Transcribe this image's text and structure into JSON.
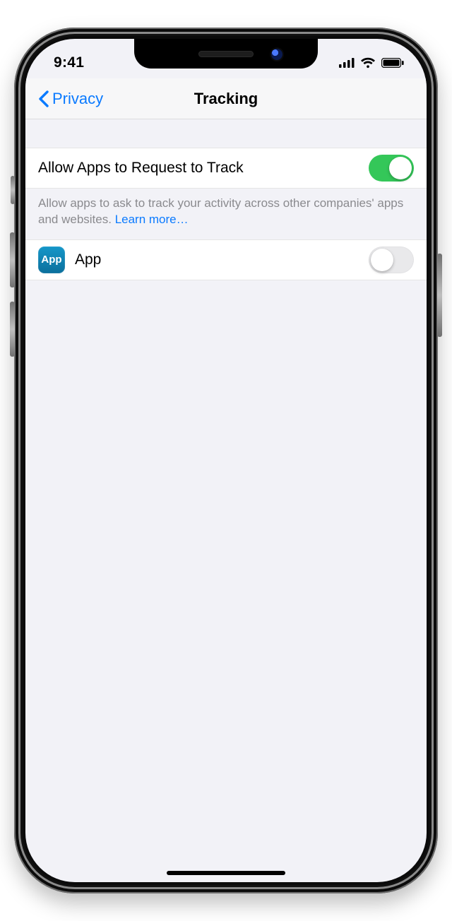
{
  "status": {
    "time": "9:41"
  },
  "nav": {
    "back_label": "Privacy",
    "title": "Tracking"
  },
  "rows": {
    "allow_label": "Allow Apps to Request to Track",
    "allow_on": true,
    "footer_text": "Allow apps to ask to track your activity across other companies' apps and websites. ",
    "footer_link": "Learn more…",
    "app": {
      "icon_text": "App",
      "label": "App",
      "on": false
    }
  }
}
